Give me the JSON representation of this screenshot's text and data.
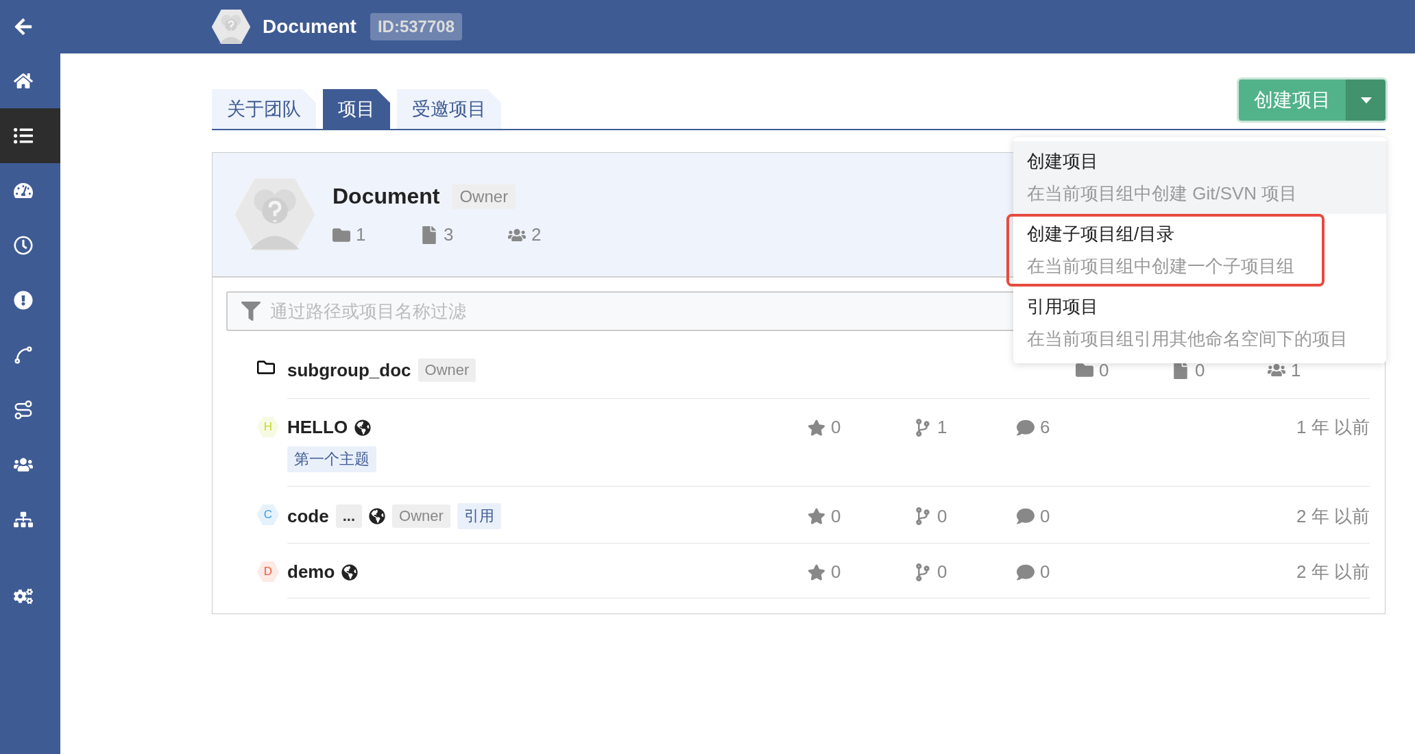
{
  "header": {
    "title": "Document",
    "id_badge": "ID:537708"
  },
  "sidebar": {
    "items": [
      {
        "selected": false
      },
      {
        "selected": true
      },
      {
        "selected": false
      },
      {
        "selected": false
      },
      {
        "selected": false
      },
      {
        "selected": false
      },
      {
        "selected": false
      },
      {
        "selected": false
      },
      {
        "selected": false
      },
      {
        "selected": false
      }
    ]
  },
  "tabs": [
    {
      "label": "关于团队",
      "selected": false
    },
    {
      "label": "项目",
      "selected": true
    },
    {
      "label": "受邀项目",
      "selected": false
    }
  ],
  "create_button": {
    "label": "创建项目"
  },
  "dropdown": {
    "items": [
      {
        "title": "创建项目",
        "description": "在当前项目组中创建 Git/SVN 项目",
        "hovered": true,
        "annotated": false
      },
      {
        "title": "创建子项目组/目录",
        "description": "在当前项目组中创建一个子项目组",
        "hovered": false,
        "annotated": true
      },
      {
        "title": "引用项目",
        "description": "在当前项目组引用其他命名空间下的项目",
        "hovered": false,
        "annotated": false
      }
    ]
  },
  "group": {
    "name": "Document",
    "role": "Owner",
    "stats": [
      {
        "kind": "folders",
        "value": "1"
      },
      {
        "kind": "files",
        "value": "3"
      },
      {
        "kind": "members",
        "value": "2"
      }
    ]
  },
  "filter": {
    "placeholder": "通过路径或项目名称过滤"
  },
  "rows": [
    {
      "kind": "group",
      "name": "subgroup_doc",
      "badges": [
        {
          "kind": "role",
          "text": "Owner"
        }
      ],
      "stats": [
        {
          "kind": "folders",
          "value": "0"
        },
        {
          "kind": "files",
          "value": "0"
        },
        {
          "kind": "members",
          "value": "1"
        }
      ]
    },
    {
      "kind": "project",
      "letter": "H",
      "color": "#c5d62e",
      "name": "HELLO",
      "public": true,
      "badges": [],
      "topics": [
        "第一个主题"
      ],
      "favorites": "0",
      "forks": "1",
      "comments": "6",
      "updated": "1 年 以前"
    },
    {
      "kind": "project",
      "letter": "C",
      "color": "#3d9be9",
      "name": "code",
      "public": true,
      "badges": [
        {
          "kind": "more",
          "text": "..."
        },
        {
          "kind": "role",
          "text": "Owner"
        },
        {
          "kind": "reference",
          "text": "引用"
        }
      ],
      "topics": [],
      "favorites": "0",
      "forks": "0",
      "comments": "0",
      "updated": "2 年 以前"
    },
    {
      "kind": "project",
      "letter": "D",
      "color": "#ef5a3c",
      "name": "demo",
      "public": true,
      "badges": [],
      "topics": [],
      "favorites": "0",
      "forks": "0",
      "comments": "0",
      "updated": "2 年 以前"
    }
  ]
}
